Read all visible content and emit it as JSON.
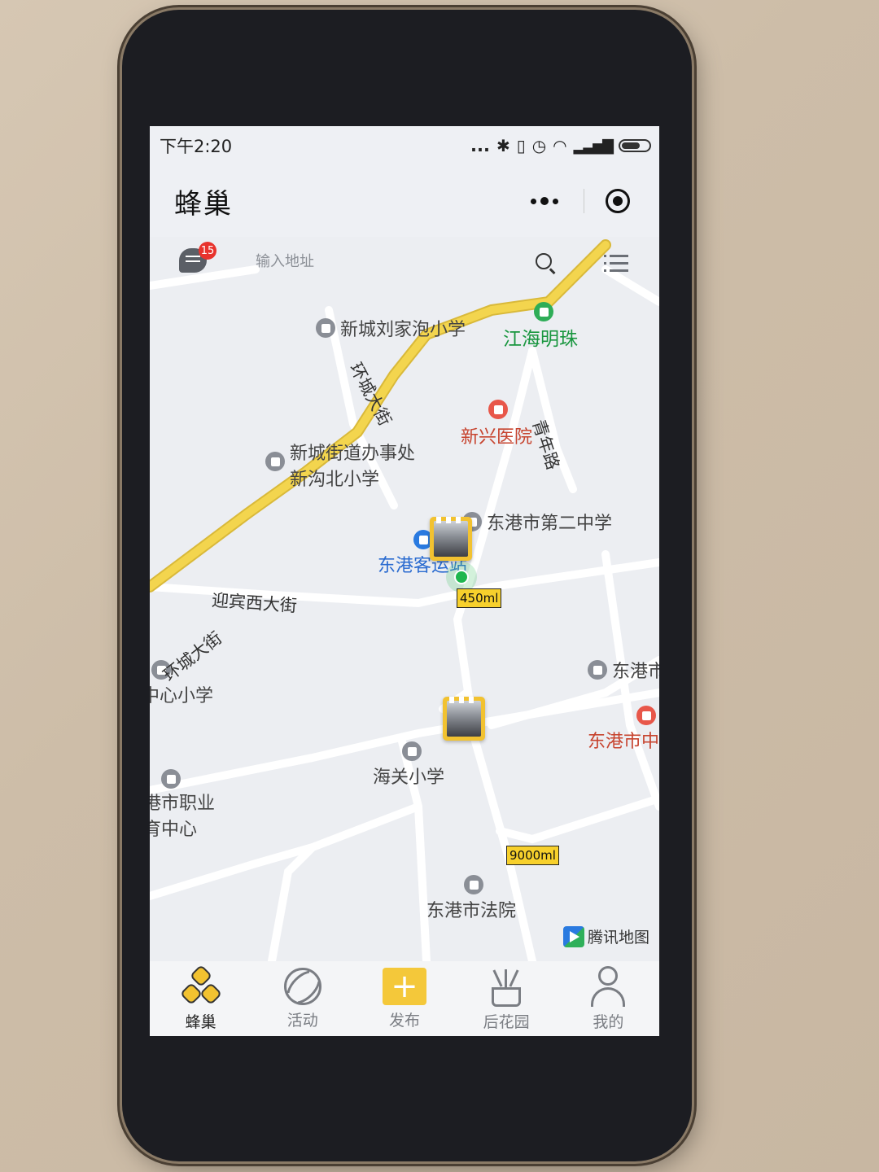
{
  "status_bar": {
    "time": "下午2:20",
    "dots": "...",
    "icons": [
      "bluetooth-icon",
      "vibrate-off-icon",
      "alarm-icon",
      "wifi-icon",
      "signal-icon",
      "battery-icon"
    ]
  },
  "header": {
    "title": "蜂巢"
  },
  "search": {
    "placeholder": "输入地址",
    "message_badge": "15"
  },
  "map": {
    "pois": [
      {
        "label": "新城刘家泡小学",
        "kind": "school"
      },
      {
        "label": "江海明珠",
        "kind": "park"
      },
      {
        "label": "新兴医院",
        "kind": "hospital"
      },
      {
        "label": "新城街道办事处",
        "kind": "office"
      },
      {
        "label": "新沟北小学",
        "kind": "school"
      },
      {
        "label": "东港市第二中学",
        "kind": "school"
      },
      {
        "label": "东港客运站",
        "kind": "bus"
      },
      {
        "label": "东港市",
        "kind": "school"
      },
      {
        "label": "中心小学",
        "kind": "school"
      },
      {
        "label": "东港市中",
        "kind": "hospital"
      },
      {
        "label": "海关小学",
        "kind": "school"
      },
      {
        "label": "港市职业",
        "kind": "school"
      },
      {
        "label": "育中心",
        "kind": "school"
      },
      {
        "label": "东港市法院",
        "kind": "court"
      }
    ],
    "roads": {
      "ring_road_1": "环城大街",
      "ring_road_2": "环城大街",
      "youth_road": "青年路",
      "yingbin_road": "迎宾西大街"
    },
    "markers": [
      {
        "volume": "450ml"
      },
      {
        "volume": "9000ml"
      }
    ],
    "provider": "腾讯地图",
    "colors": {
      "road_highlight": "#f3d54e",
      "marker": "#f2c230"
    }
  },
  "tabs": [
    {
      "label": "蜂巢",
      "icon": "honeycomb-icon",
      "active": true
    },
    {
      "label": "活动",
      "icon": "ball-icon",
      "active": false
    },
    {
      "label": "发布",
      "icon": "plus-icon",
      "active": false
    },
    {
      "label": "后花园",
      "icon": "plant-icon",
      "active": false
    },
    {
      "label": "我的",
      "icon": "person-icon",
      "active": false
    }
  ]
}
